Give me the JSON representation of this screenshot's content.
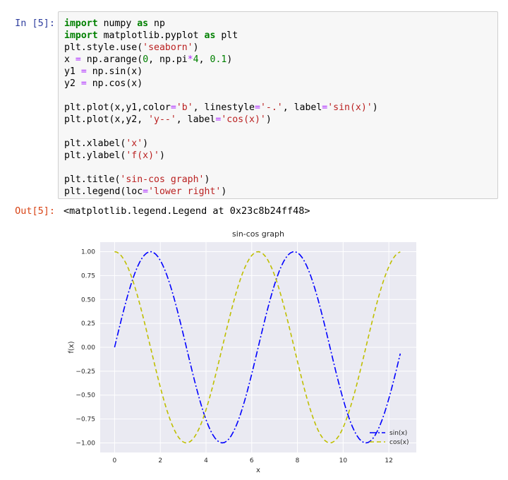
{
  "input_cell": {
    "prompt": "In [5]:",
    "code_lines": [
      [
        [
          "kw",
          "import"
        ],
        [
          "n",
          " numpy "
        ],
        [
          "kw",
          "as"
        ],
        [
          "n",
          " np"
        ]
      ],
      [
        [
          "kw",
          "import"
        ],
        [
          "n",
          " matplotlib.pyplot "
        ],
        [
          "kw",
          "as"
        ],
        [
          "n",
          " plt"
        ]
      ],
      [
        [
          "n",
          "plt.style.use("
        ],
        [
          "str",
          "'seaborn'"
        ],
        [
          "n",
          ")"
        ]
      ],
      [
        [
          "n",
          "x "
        ],
        [
          "op",
          "="
        ],
        [
          "n",
          " np.arange("
        ],
        [
          "num",
          "0"
        ],
        [
          "n",
          ", np.pi"
        ],
        [
          "op",
          "*"
        ],
        [
          "num",
          "4"
        ],
        [
          "n",
          ", "
        ],
        [
          "num",
          "0.1"
        ],
        [
          "n",
          ")"
        ]
      ],
      [
        [
          "n",
          "y1 "
        ],
        [
          "op",
          "="
        ],
        [
          "n",
          " np.sin(x)"
        ]
      ],
      [
        [
          "n",
          "y2 "
        ],
        [
          "op",
          "="
        ],
        [
          "n",
          " np.cos(x)"
        ]
      ],
      [],
      [
        [
          "n",
          "plt.plot(x,y1,color"
        ],
        [
          "op",
          "="
        ],
        [
          "str",
          "'b'"
        ],
        [
          "n",
          ", linestyle"
        ],
        [
          "op",
          "="
        ],
        [
          "str",
          "'-.'"
        ],
        [
          "n",
          ", label"
        ],
        [
          "op",
          "="
        ],
        [
          "str",
          "'sin(x)'"
        ],
        [
          "n",
          ")"
        ]
      ],
      [
        [
          "n",
          "plt.plot(x,y2, "
        ],
        [
          "str",
          "'y--'"
        ],
        [
          "n",
          ", label"
        ],
        [
          "op",
          "="
        ],
        [
          "str",
          "'cos(x)'"
        ],
        [
          "n",
          ")"
        ]
      ],
      [],
      [
        [
          "n",
          "plt.xlabel("
        ],
        [
          "str",
          "'x'"
        ],
        [
          "n",
          ")"
        ]
      ],
      [
        [
          "n",
          "plt.ylabel("
        ],
        [
          "str",
          "'f(x)'"
        ],
        [
          "n",
          ")"
        ]
      ],
      [],
      [
        [
          "n",
          "plt.title("
        ],
        [
          "str",
          "'sin-cos graph'"
        ],
        [
          "n",
          ")"
        ]
      ],
      [
        [
          "n",
          "plt.legend(loc"
        ],
        [
          "op",
          "="
        ],
        [
          "str",
          "'lower right'"
        ],
        [
          "n",
          ")"
        ]
      ]
    ]
  },
  "output_cell": {
    "prompt": "Out[5]:",
    "text": "<matplotlib.legend.Legend at 0x23c8b24ff48>"
  },
  "colors": {
    "prompt_in": "#303f9f",
    "prompt_out": "#d84315",
    "plot_bg": "#eaeaf2",
    "sin_line": "#0000ff",
    "cos_line": "#bfbf00"
  },
  "chart_data": {
    "type": "line",
    "title": "sin-cos graph",
    "xlabel": "x",
    "ylabel": "f(x)",
    "xlim": [
      -0.63,
      13.2
    ],
    "ylim": [
      -1.1,
      1.1
    ],
    "xticks": [
      0,
      2,
      4,
      6,
      8,
      10,
      12
    ],
    "yticks": [
      1.0,
      0.75,
      0.5,
      0.25,
      0.0,
      -0.25,
      -0.5,
      -0.75,
      -1.0
    ],
    "ytick_labels": [
      "1.00",
      "0.75",
      "0.50",
      "0.25",
      "0.00",
      "−0.25",
      "−0.50",
      "−0.75",
      "−1.00"
    ],
    "grid": true,
    "legend_location": "lower right",
    "x_range": {
      "start": 0,
      "step": 0.1,
      "end": 12.566
    },
    "series": [
      {
        "name": "sin(x)",
        "function": "sin",
        "color": "#0000ff",
        "linestyle": "-."
      },
      {
        "name": "cos(x)",
        "function": "cos",
        "color": "#bfbf00",
        "linestyle": "--"
      }
    ]
  }
}
